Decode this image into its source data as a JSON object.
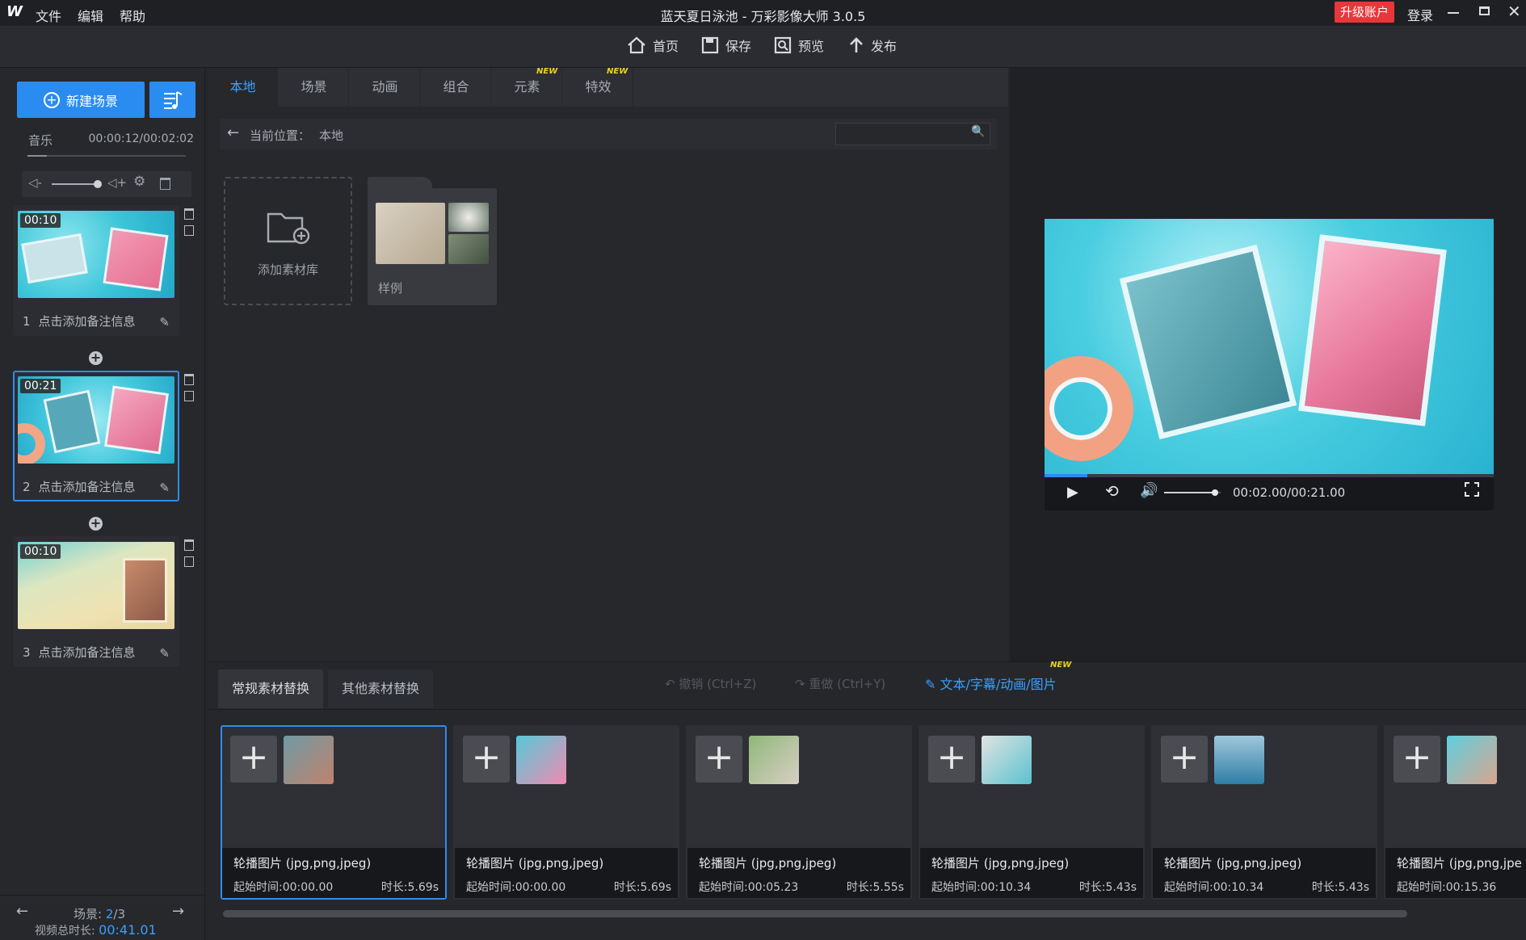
{
  "app": {
    "logo": "W",
    "title": "蓝天夏日泳池 - 万彩影像大师 3.0.5",
    "upgrade": "升级账户",
    "login": "登录"
  },
  "menu": [
    "文件",
    "编辑",
    "帮助"
  ],
  "toolbar": {
    "home": "首页",
    "save": "保存",
    "preview": "预览",
    "publish": "发布"
  },
  "left": {
    "new_scene": "新建场景",
    "music_label": "音乐",
    "music_time": "00:00:12/00:02:02",
    "scenes": [
      {
        "num": "1",
        "time": "00:10",
        "note": "点击添加备注信息"
      },
      {
        "num": "2",
        "time": "00:21",
        "note": "点击添加备注信息"
      },
      {
        "num": "3",
        "time": "00:10",
        "note": "点击添加备注信息"
      }
    ],
    "scene_label": "场景:",
    "scene_current": "2",
    "scene_total": "/3",
    "total_label": "视频总时长:",
    "total_time": "00:41.01"
  },
  "tabs": [
    {
      "label": "本地"
    },
    {
      "label": "场景"
    },
    {
      "label": "动画"
    },
    {
      "label": "组合"
    },
    {
      "label": "元素",
      "badge": "NEW"
    },
    {
      "label": "特效",
      "badge": "NEW"
    }
  ],
  "location": {
    "label": "当前位置：",
    "value": "本地",
    "search_placeholder": ""
  },
  "library": {
    "add": "添加素材库",
    "sample": "样例"
  },
  "player": {
    "time": "00:02.00/00:21.00",
    "progress": 0.095,
    "volume": 0.9
  },
  "bottom": {
    "tab_regular": "常规素材替换",
    "tab_other": "其他素材替换",
    "undo": "撤销 (Ctrl+Z)",
    "redo": "重做 (Ctrl+Y)",
    "text_edit": "文本/字幕/动画/图片",
    "text_badge": "NEW",
    "cards": [
      {
        "title": "轮播图片 (jpg,png,jpeg)",
        "start": "起始时间:00:00.00",
        "dur": "时长:5.69s"
      },
      {
        "title": "轮播图片 (jpg,png,jpeg)",
        "start": "起始时间:00:00.00",
        "dur": "时长:5.69s"
      },
      {
        "title": "轮播图片 (jpg,png,jpeg)",
        "start": "起始时间:00:05.23",
        "dur": "时长:5.55s"
      },
      {
        "title": "轮播图片 (jpg,png,jpeg)",
        "start": "起始时间:00:10.34",
        "dur": "时长:5.43s"
      },
      {
        "title": "轮播图片 (jpg,png,jpeg)",
        "start": "起始时间:00:10.34",
        "dur": "时长:5.43s"
      },
      {
        "title": "轮播图片 (jpg,png,jpe",
        "start": "起始时间:00:15.36",
        "dur": ""
      }
    ]
  }
}
